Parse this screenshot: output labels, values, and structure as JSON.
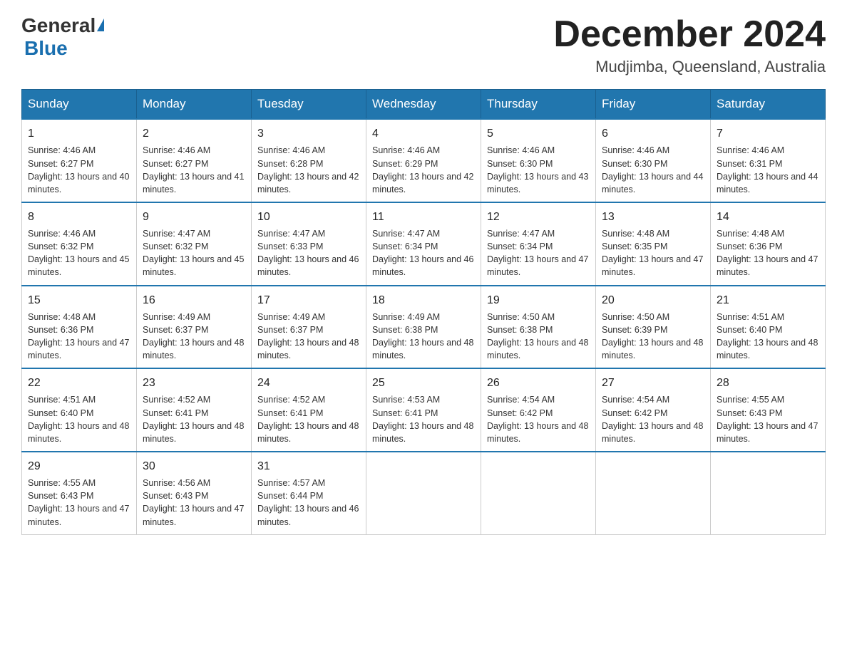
{
  "header": {
    "logo_general": "General",
    "logo_blue": "Blue",
    "month_title": "December 2024",
    "location": "Mudjimba, Queensland, Australia"
  },
  "days_of_week": [
    "Sunday",
    "Monday",
    "Tuesday",
    "Wednesday",
    "Thursday",
    "Friday",
    "Saturday"
  ],
  "weeks": [
    [
      {
        "day": "1",
        "sunrise": "4:46 AM",
        "sunset": "6:27 PM",
        "daylight": "13 hours and 40 minutes."
      },
      {
        "day": "2",
        "sunrise": "4:46 AM",
        "sunset": "6:27 PM",
        "daylight": "13 hours and 41 minutes."
      },
      {
        "day": "3",
        "sunrise": "4:46 AM",
        "sunset": "6:28 PM",
        "daylight": "13 hours and 42 minutes."
      },
      {
        "day": "4",
        "sunrise": "4:46 AM",
        "sunset": "6:29 PM",
        "daylight": "13 hours and 42 minutes."
      },
      {
        "day": "5",
        "sunrise": "4:46 AM",
        "sunset": "6:30 PM",
        "daylight": "13 hours and 43 minutes."
      },
      {
        "day": "6",
        "sunrise": "4:46 AM",
        "sunset": "6:30 PM",
        "daylight": "13 hours and 44 minutes."
      },
      {
        "day": "7",
        "sunrise": "4:46 AM",
        "sunset": "6:31 PM",
        "daylight": "13 hours and 44 minutes."
      }
    ],
    [
      {
        "day": "8",
        "sunrise": "4:46 AM",
        "sunset": "6:32 PM",
        "daylight": "13 hours and 45 minutes."
      },
      {
        "day": "9",
        "sunrise": "4:47 AM",
        "sunset": "6:32 PM",
        "daylight": "13 hours and 45 minutes."
      },
      {
        "day": "10",
        "sunrise": "4:47 AM",
        "sunset": "6:33 PM",
        "daylight": "13 hours and 46 minutes."
      },
      {
        "day": "11",
        "sunrise": "4:47 AM",
        "sunset": "6:34 PM",
        "daylight": "13 hours and 46 minutes."
      },
      {
        "day": "12",
        "sunrise": "4:47 AM",
        "sunset": "6:34 PM",
        "daylight": "13 hours and 47 minutes."
      },
      {
        "day": "13",
        "sunrise": "4:48 AM",
        "sunset": "6:35 PM",
        "daylight": "13 hours and 47 minutes."
      },
      {
        "day": "14",
        "sunrise": "4:48 AM",
        "sunset": "6:36 PM",
        "daylight": "13 hours and 47 minutes."
      }
    ],
    [
      {
        "day": "15",
        "sunrise": "4:48 AM",
        "sunset": "6:36 PM",
        "daylight": "13 hours and 47 minutes."
      },
      {
        "day": "16",
        "sunrise": "4:49 AM",
        "sunset": "6:37 PM",
        "daylight": "13 hours and 48 minutes."
      },
      {
        "day": "17",
        "sunrise": "4:49 AM",
        "sunset": "6:37 PM",
        "daylight": "13 hours and 48 minutes."
      },
      {
        "day": "18",
        "sunrise": "4:49 AM",
        "sunset": "6:38 PM",
        "daylight": "13 hours and 48 minutes."
      },
      {
        "day": "19",
        "sunrise": "4:50 AM",
        "sunset": "6:38 PM",
        "daylight": "13 hours and 48 minutes."
      },
      {
        "day": "20",
        "sunrise": "4:50 AM",
        "sunset": "6:39 PM",
        "daylight": "13 hours and 48 minutes."
      },
      {
        "day": "21",
        "sunrise": "4:51 AM",
        "sunset": "6:40 PM",
        "daylight": "13 hours and 48 minutes."
      }
    ],
    [
      {
        "day": "22",
        "sunrise": "4:51 AM",
        "sunset": "6:40 PM",
        "daylight": "13 hours and 48 minutes."
      },
      {
        "day": "23",
        "sunrise": "4:52 AM",
        "sunset": "6:41 PM",
        "daylight": "13 hours and 48 minutes."
      },
      {
        "day": "24",
        "sunrise": "4:52 AM",
        "sunset": "6:41 PM",
        "daylight": "13 hours and 48 minutes."
      },
      {
        "day": "25",
        "sunrise": "4:53 AM",
        "sunset": "6:41 PM",
        "daylight": "13 hours and 48 minutes."
      },
      {
        "day": "26",
        "sunrise": "4:54 AM",
        "sunset": "6:42 PM",
        "daylight": "13 hours and 48 minutes."
      },
      {
        "day": "27",
        "sunrise": "4:54 AM",
        "sunset": "6:42 PM",
        "daylight": "13 hours and 48 minutes."
      },
      {
        "day": "28",
        "sunrise": "4:55 AM",
        "sunset": "6:43 PM",
        "daylight": "13 hours and 47 minutes."
      }
    ],
    [
      {
        "day": "29",
        "sunrise": "4:55 AM",
        "sunset": "6:43 PM",
        "daylight": "13 hours and 47 minutes."
      },
      {
        "day": "30",
        "sunrise": "4:56 AM",
        "sunset": "6:43 PM",
        "daylight": "13 hours and 47 minutes."
      },
      {
        "day": "31",
        "sunrise": "4:57 AM",
        "sunset": "6:44 PM",
        "daylight": "13 hours and 46 minutes."
      },
      null,
      null,
      null,
      null
    ]
  ]
}
